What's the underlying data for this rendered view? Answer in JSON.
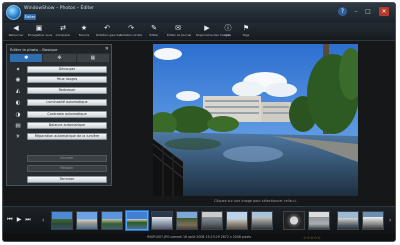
{
  "window": {
    "title": "WindowShow – Photos – Éditer",
    "edit_tab": "Éditer",
    "controls": {
      "help": "?",
      "minimize": "–",
      "maximize": "□",
      "close": "✕"
    }
  },
  "toolbar": {
    "items": [
      {
        "icon": "◀",
        "label": "Retourner",
        "icon_name": "back-arrow-icon"
      },
      {
        "icon": "▣",
        "label": "Enregistrer sous",
        "icon_name": "save-icon"
      },
      {
        "icon": "⇄",
        "label": "Comparer",
        "icon_name": "compare-icon"
      },
      {
        "icon": "★",
        "label": "Favoris",
        "icon_name": "star-icon"
      },
      {
        "icon": "↶",
        "label": "Rotation gauche",
        "icon_name": "rotate-left-icon"
      },
      {
        "icon": "↷",
        "label": "Rotation droite",
        "icon_name": "rotate-right-icon"
      },
      {
        "icon": "✎",
        "label": "Éditer",
        "icon_name": "edit-icon"
      },
      {
        "icon": "✉",
        "label": "Éditer et Journal",
        "icon_name": "mail-icon"
      },
      {
        "icon": "▶",
        "label": "Diaporama des images",
        "icon_name": "slideshow-icon"
      },
      {
        "icon": "ⓘ",
        "label": "Info",
        "icon_name": "info-icon"
      },
      {
        "icon": "⚑",
        "label": "Tags",
        "icon_name": "tag-icon"
      }
    ]
  },
  "panel": {
    "title": "Éditer la photo – Basique",
    "close": "✕",
    "tabs": [
      "✱",
      "✥",
      "▦"
    ],
    "active_tab": 0,
    "rows": [
      {
        "icon": "✦",
        "icon_name": "sparkle-icon",
        "label": "Découper",
        "enabled": true
      },
      {
        "icon": "◉",
        "icon_name": "eye-icon",
        "label": "Yeux rouges",
        "enabled": true
      },
      {
        "icon": "◭",
        "icon_name": "straighten-icon",
        "label": "Redresser",
        "enabled": true
      },
      {
        "icon": "◐",
        "icon_name": "brightness-icon",
        "label": "Luminosité automatique",
        "enabled": true
      },
      {
        "icon": "◑",
        "icon_name": "contrast-icon",
        "label": "Contraste automatique",
        "enabled": true
      },
      {
        "icon": "▤",
        "icon_name": "balance-icon",
        "label": "Balance automatique",
        "enabled": true
      },
      {
        "icon": "☀",
        "icon_name": "light-icon",
        "label": "Réparation automatique de la lumière",
        "enabled": true
      }
    ],
    "bottom_buttons": [
      {
        "label": "Annuler",
        "enabled": false
      },
      {
        "label": "Rétablir",
        "enabled": false
      },
      {
        "label": "Terminer",
        "enabled": true
      }
    ]
  },
  "photo_hint": "Cliquez sur une image pour sélectionner celle-ci.",
  "filmstrip": {
    "controls": [
      "⏮",
      "▶",
      "⏭"
    ],
    "selected_index": 3,
    "thumbnail_count": 12
  },
  "status": {
    "text": "IMGP1007.JPG  samedi 16 août 2008 15:23:29  2672 x 2008 pixels",
    "stars": "☆☆☆☆☆"
  },
  "colors": {
    "accent": "#2e6db0",
    "background": "#151719",
    "panel": "#272c30"
  }
}
